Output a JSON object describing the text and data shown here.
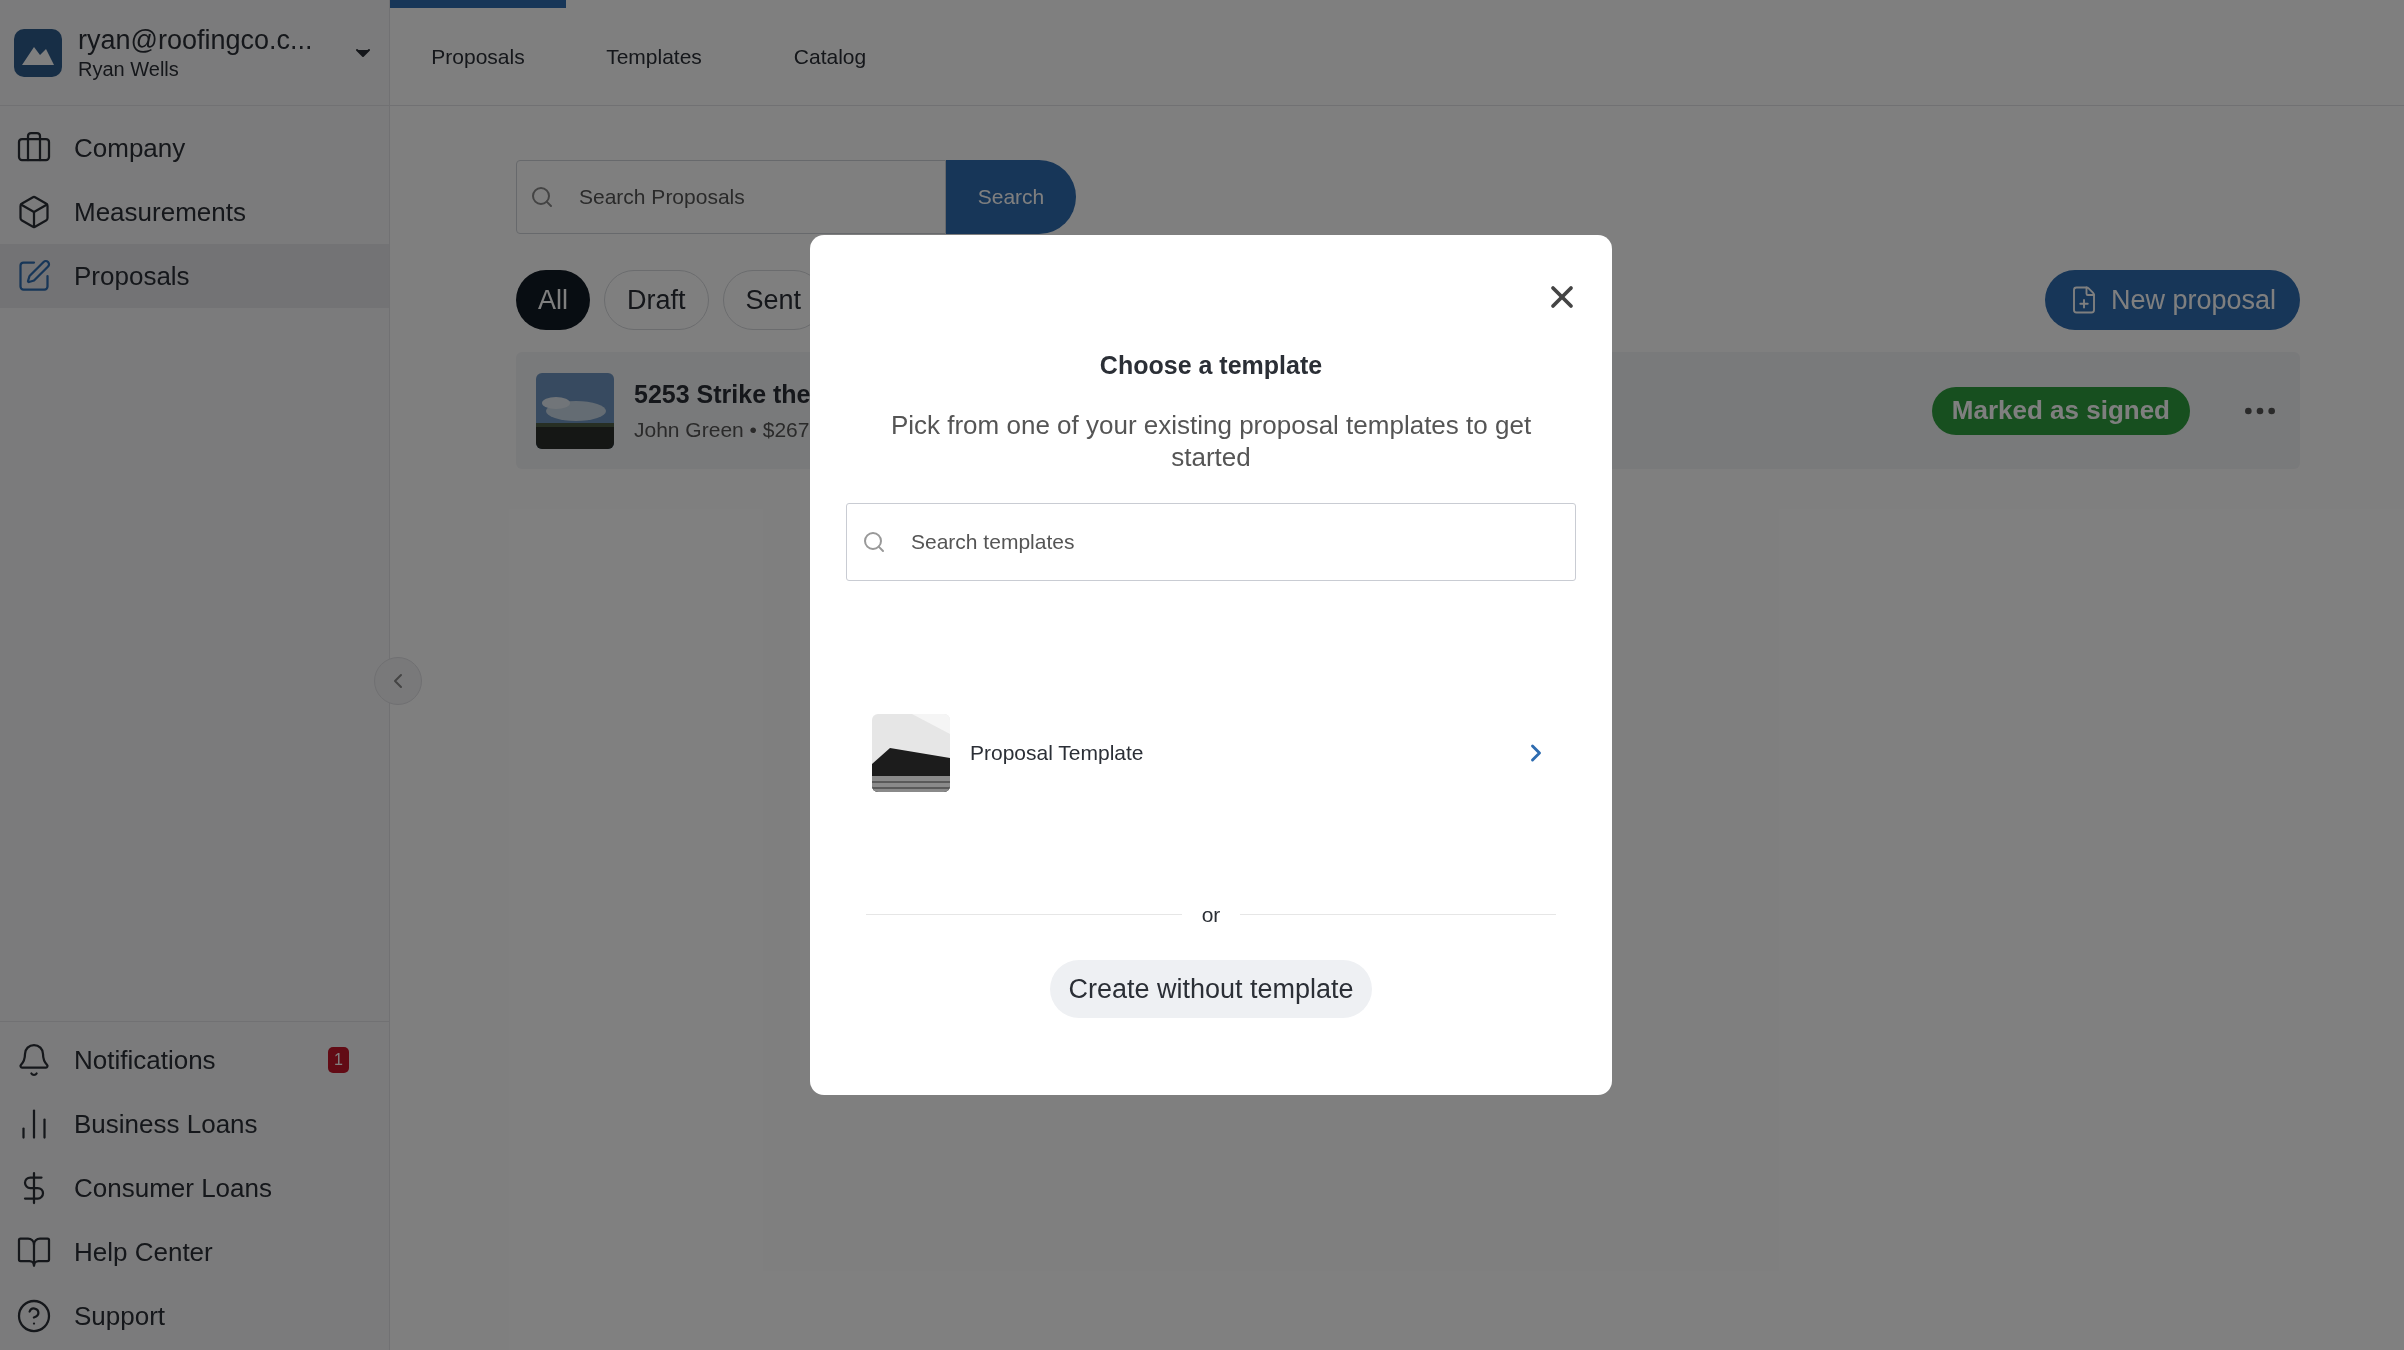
{
  "account": {
    "email": "ryan@roofingco.c...",
    "name": "Ryan Wells"
  },
  "top_tabs": [
    {
      "label": "Proposals",
      "selected": true
    },
    {
      "label": "Templates",
      "selected": false
    },
    {
      "label": "Catalog",
      "selected": false
    }
  ],
  "sidebar": {
    "items": [
      {
        "label": "Company",
        "selected": false
      },
      {
        "label": "Measurements",
        "selected": false
      },
      {
        "label": "Proposals",
        "selected": true
      }
    ],
    "bottom_items": [
      {
        "label": "Notifications",
        "badge": "1"
      },
      {
        "label": "Business Loans"
      },
      {
        "label": "Consumer Loans"
      },
      {
        "label": "Help Center"
      },
      {
        "label": "Support"
      }
    ]
  },
  "search": {
    "placeholder": "Search Proposals",
    "button": "Search"
  },
  "filters": [
    {
      "label": "All",
      "selected": true
    },
    {
      "label": "Draft",
      "selected": false
    },
    {
      "label": "Sent",
      "selected": false
    }
  ],
  "new_proposal_button": "New proposal",
  "proposals": [
    {
      "title": "5253 Strike the",
      "subtitle": "John Green • $267",
      "status": "Marked as signed"
    }
  ],
  "modal": {
    "title": "Choose a template",
    "subtitle": "Pick from one of your existing proposal templates to get started",
    "search_placeholder": "Search templates",
    "templates": [
      {
        "name": "Proposal Template"
      }
    ],
    "divider_text": "or",
    "create_button": "Create without template"
  }
}
